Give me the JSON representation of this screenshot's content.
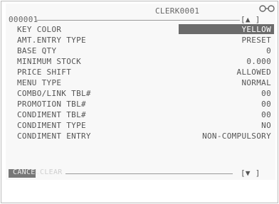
{
  "header": {
    "clerk_label": "CLERK0001",
    "code": "000001",
    "scroll_up_label": "[▲ ]"
  },
  "rows": [
    {
      "label": "KEY COLOR",
      "value": "YELLOW"
    },
    {
      "label": "AMT.ENTRY TYPE",
      "value": "PRESET"
    },
    {
      "label": "BASE QTY",
      "value": "0"
    },
    {
      "label": "MINIMUM STOCK",
      "value": "0.000"
    },
    {
      "label": "PRICE SHIFT",
      "value": "ALLOWED"
    },
    {
      "label": "MENU TYPE",
      "value": "NORMAL"
    },
    {
      "label": "COMBO/LINK TBL#",
      "value": "00"
    },
    {
      "label": "PROMOTION TBL#",
      "value": "00"
    },
    {
      "label": "CONDIMENT TBL#",
      "value": "00"
    },
    {
      "label": "CONDIMENT TYPE",
      "value": "NO"
    },
    {
      "label": "CONDIMENT ENTRY",
      "value": "NON-COMPULSORY"
    }
  ],
  "footer": {
    "cancel_label": "CANCEL",
    "ghost_label": "CLEAR",
    "scroll_down_label": "[▼ ]"
  },
  "icons": {
    "status_icon": "glasses-icon"
  }
}
